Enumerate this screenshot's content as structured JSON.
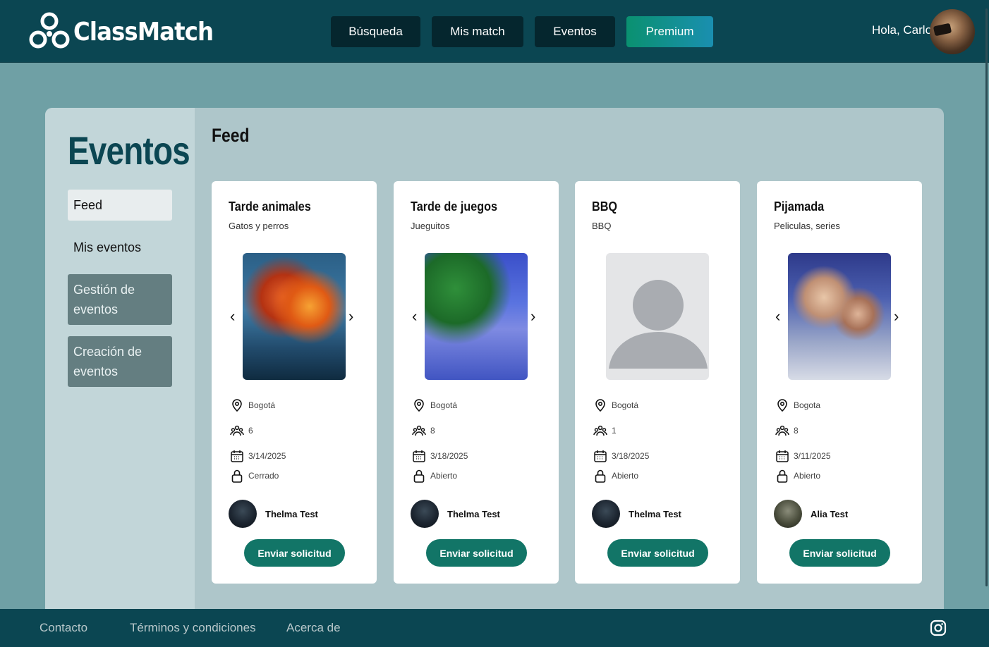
{
  "header": {
    "logo_text": "ClassMatch",
    "nav": [
      {
        "label": "Búsqueda"
      },
      {
        "label": "Mis match"
      },
      {
        "label": "Eventos"
      },
      {
        "label": "Premium"
      }
    ],
    "greeting": "Hola, Carlos"
  },
  "sidebar": {
    "title": "Eventos",
    "items": [
      {
        "label": "Feed"
      },
      {
        "label": "Mis eventos"
      },
      {
        "label": "Gestión de eventos"
      },
      {
        "label": "Creación de eventos"
      }
    ]
  },
  "feed": {
    "title": "Feed",
    "send_label": "Enviar solicitud",
    "cards": [
      {
        "title": "Tarde animales",
        "subtitle": "Gatos y perros",
        "city": "Bogotá",
        "people": "6",
        "date": "3/14/2025",
        "status": "Cerrado",
        "owner": "Thelma Test"
      },
      {
        "title": "Tarde de juegos",
        "subtitle": "Jueguitos",
        "city": "Bogotá",
        "people": "8",
        "date": "3/18/2025",
        "status": "Abierto",
        "owner": "Thelma Test"
      },
      {
        "title": "BBQ",
        "subtitle": "BBQ",
        "city": "Bogotá",
        "people": "1",
        "date": "3/18/2025",
        "status": "Abierto",
        "owner": "Thelma Test"
      },
      {
        "title": "Pijamada",
        "subtitle": "Peliculas, series",
        "city": "Bogota",
        "people": "8",
        "date": "3/11/2025",
        "status": "Abierto",
        "owner": "Alia Test"
      }
    ]
  },
  "footer": {
    "links": [
      {
        "label": "Contacto"
      },
      {
        "label": "Términos y condiciones"
      },
      {
        "label": "Acerca de"
      }
    ]
  },
  "colors": {
    "header_bg": "#0b4652",
    "page_bg": "#6fa0a5",
    "accent_button": "#127567",
    "premium_gradient_start": "#0a9170",
    "premium_gradient_end": "#1a8fb0"
  }
}
